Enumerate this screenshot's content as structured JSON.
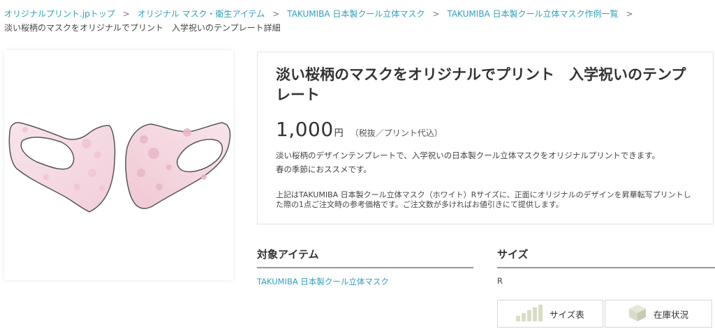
{
  "breadcrumb": {
    "items": [
      "オリジナルプリント.jpトップ",
      "オリジナル マスク・衛生アイテム",
      "TAKUMIBA 日本製クール立体マスク",
      "TAKUMIBA 日本製クール立体マスク作例一覧"
    ],
    "separator": ">",
    "current": "淡い桜柄のマスクをオリジナルでプリント　入学祝いのテンプレート詳細"
  },
  "product": {
    "title": "淡い桜柄のマスクをオリジナルでプリント　入学祝いのテンプレート",
    "price": "1,000",
    "yen": "円",
    "tax_note": "（税抜／プリント代込）",
    "description_1": "淡い桜柄のデザインテンプレートで、入学祝いの日本製クール立体マスクをオリジナルプリントできます。",
    "description_2": "春の季節におススメです。",
    "note": "上記はTAKUMIBA 日本製クール立体マスク（ホワイト）Rサイズに、正面にオリジナルのデザインを昇華転写プリントした際の1点ご注文時の参考価格です。ご注文数が多ければお値引きにて提供します。"
  },
  "details": {
    "item_heading": "対象アイテム",
    "item_link": "TAKUMIBA 日本製クール立体マスク",
    "size_heading": "サイズ",
    "size_value": "R"
  },
  "buttons": {
    "size_chart": "サイズ表",
    "stock": "在庫状況"
  },
  "colors": {
    "link": "#2e9fbd",
    "icon": "#d9dcc6",
    "mask_pink": "#f6dce4"
  },
  "icons": {
    "size_chart": "bar-chart-icon",
    "stock": "box-icon"
  }
}
